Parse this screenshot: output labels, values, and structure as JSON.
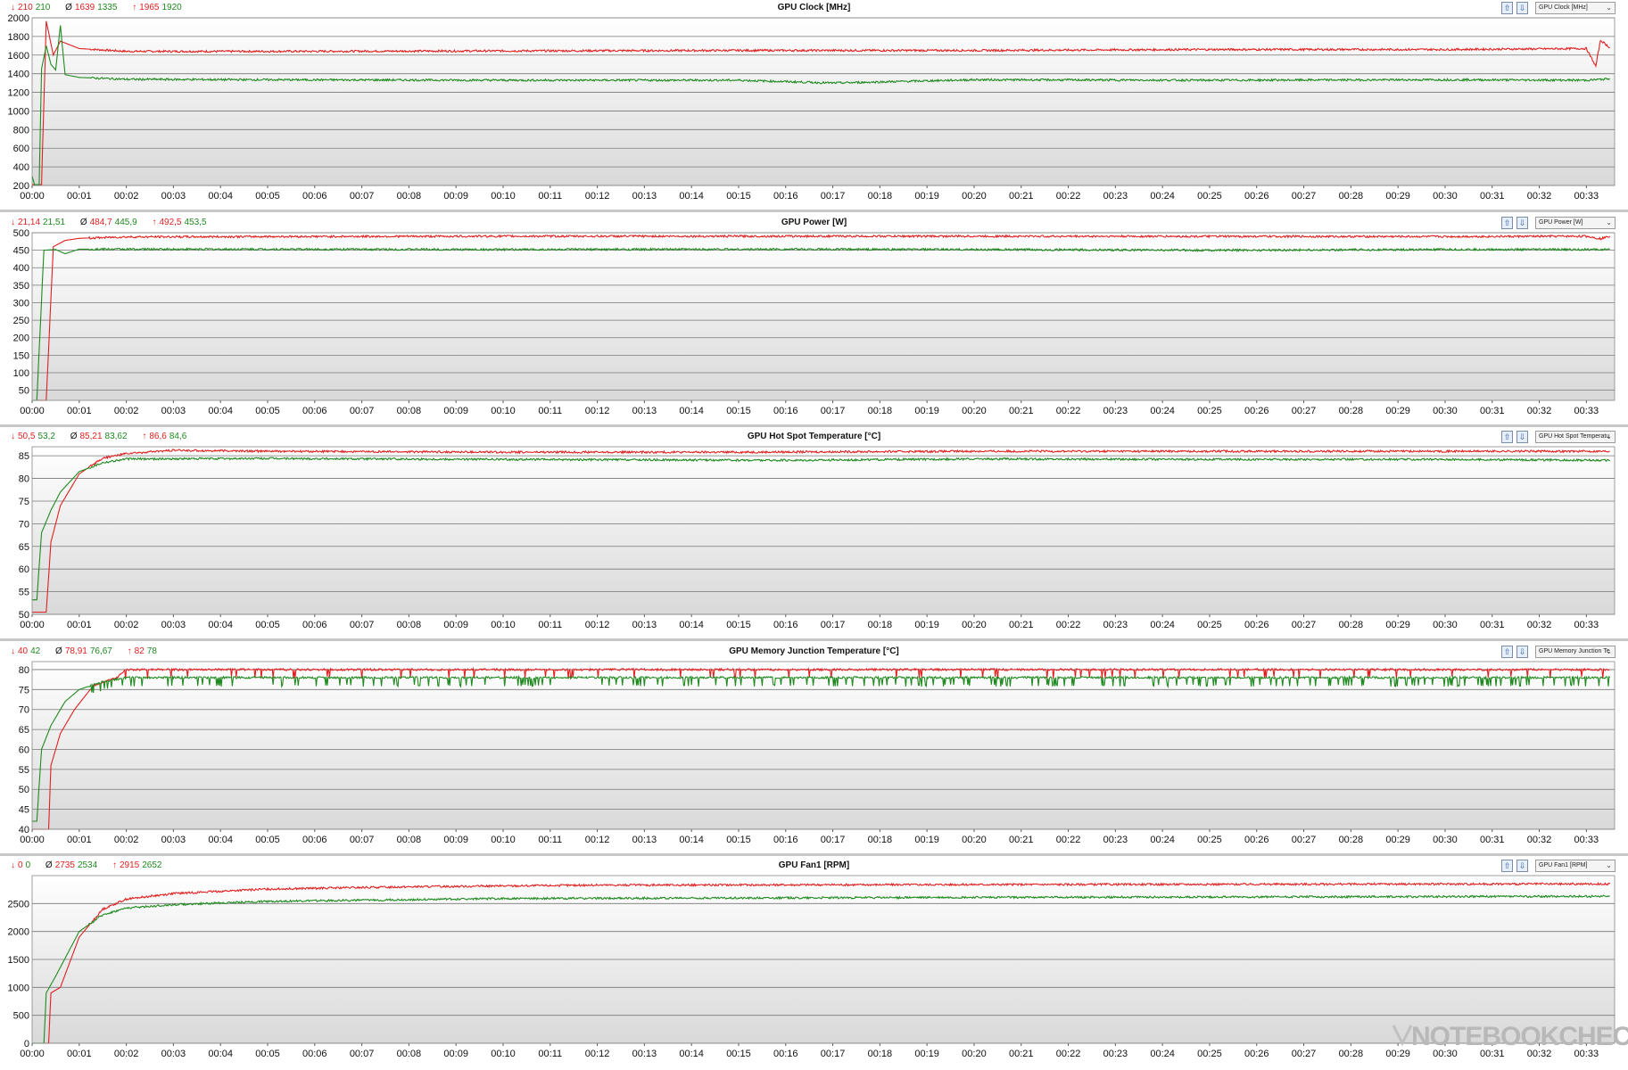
{
  "watermark": "NOTEBOOKCHECK",
  "colors": {
    "series_a": "#e02020",
    "series_b": "#1f8a1f",
    "grid": "#777777"
  },
  "time_labels": [
    "00:00",
    "00:01",
    "00:02",
    "00:03",
    "00:04",
    "00:05",
    "00:06",
    "00:07",
    "00:08",
    "00:09",
    "00:10",
    "00:11",
    "00:12",
    "00:13",
    "00:14",
    "00:15",
    "00:16",
    "00:17",
    "00:18",
    "00:19",
    "00:20",
    "00:21",
    "00:22",
    "00:23",
    "00:24",
    "00:25",
    "00:26",
    "00:27",
    "00:28",
    "00:29",
    "00:30",
    "00:31",
    "00:32",
    "00:33"
  ],
  "panels": [
    {
      "title": "GPU Clock [MHz]",
      "select_label": "GPU Clock [MHz]",
      "stats": {
        "min_a": "210",
        "min_b": "210",
        "avg_a": "1639",
        "avg_b": "1335",
        "max_a": "1965",
        "max_b": "1920"
      }
    },
    {
      "title": "GPU Power [W]",
      "select_label": "GPU Power [W]",
      "stats": {
        "min_a": "21,14",
        "min_b": "21,51",
        "avg_a": "484,7",
        "avg_b": "445,9",
        "max_a": "492,5",
        "max_b": "453,5"
      }
    },
    {
      "title": "GPU Hot Spot Temperature [°C]",
      "select_label": "GPU Hot Spot Temperatu",
      "stats": {
        "min_a": "50,5",
        "min_b": "53,2",
        "avg_a": "85,21",
        "avg_b": "83,62",
        "max_a": "86,6",
        "max_b": "84,6"
      }
    },
    {
      "title": "GPU Memory Junction Temperature [°C]",
      "select_label": "GPU Memory Junction Te",
      "stats": {
        "min_a": "40",
        "min_b": "42",
        "avg_a": "78,91",
        "avg_b": "76,67",
        "max_a": "82",
        "max_b": "78"
      }
    },
    {
      "title": "GPU Fan1 [RPM]",
      "select_label": "GPU Fan1 [RPM]",
      "stats": {
        "min_a": "0",
        "min_b": "0",
        "avg_a": "2735",
        "avg_b": "2534",
        "max_a": "2915",
        "max_b": "2652"
      }
    }
  ],
  "chart_data": [
    {
      "type": "line",
      "title": "GPU Clock [MHz]",
      "ylim": [
        200,
        2000
      ],
      "yticks": [
        "200",
        "400",
        "600",
        "800",
        "1000",
        "1200",
        "1400",
        "1600",
        "1800",
        "2000"
      ],
      "x_range_min": [
        0,
        33.6
      ],
      "series": [
        {
          "points": [
            [
              0,
              210
            ],
            [
              0.2,
              210
            ],
            [
              0.3,
              1965
            ],
            [
              0.45,
              1600
            ],
            [
              0.6,
              1750
            ],
            [
              1,
              1670
            ],
            [
              2,
              1640
            ],
            [
              5,
              1640
            ],
            [
              10,
              1645
            ],
            [
              15,
              1650
            ],
            [
              20,
              1650
            ],
            [
              25,
              1660
            ],
            [
              30,
              1660
            ],
            [
              33,
              1670
            ],
            [
              33.2,
              1480
            ],
            [
              33.3,
              1760
            ],
            [
              33.5,
              1680
            ]
          ]
        },
        {
          "points": [
            [
              0,
              300
            ],
            [
              0.05,
              210
            ],
            [
              0.15,
              210
            ],
            [
              0.2,
              1450
            ],
            [
              0.3,
              1700
            ],
            [
              0.4,
              1500
            ],
            [
              0.5,
              1440
            ],
            [
              0.6,
              1920
            ],
            [
              0.7,
              1390
            ],
            [
              1,
              1360
            ],
            [
              2,
              1340
            ],
            [
              5,
              1335
            ],
            [
              10,
              1330
            ],
            [
              15,
              1330
            ],
            [
              17,
              1300
            ],
            [
              20,
              1335
            ],
            [
              25,
              1330
            ],
            [
              30,
              1335
            ],
            [
              33,
              1330
            ],
            [
              33.5,
              1345
            ]
          ]
        }
      ]
    },
    {
      "type": "line",
      "title": "GPU Power [W]",
      "ylim": [
        21,
        500
      ],
      "yticks": [
        "50",
        "100",
        "150",
        "200",
        "250",
        "300",
        "350",
        "400",
        "450",
        "500"
      ],
      "x_range_min": [
        0,
        33.6
      ],
      "series": [
        {
          "points": [
            [
              0,
              21
            ],
            [
              0.3,
              21
            ],
            [
              0.45,
              460
            ],
            [
              0.7,
              478
            ],
            [
              1,
              484
            ],
            [
              2,
              488
            ],
            [
              5,
              489
            ],
            [
              10,
              490
            ],
            [
              20,
              490
            ],
            [
              30,
              489
            ],
            [
              33,
              490
            ],
            [
              33.3,
              483
            ],
            [
              33.5,
              490
            ]
          ]
        },
        {
          "points": [
            [
              0,
              21
            ],
            [
              0.1,
              21
            ],
            [
              0.25,
              450
            ],
            [
              0.5,
              452
            ],
            [
              0.7,
              440
            ],
            [
              1,
              453
            ],
            [
              5,
              453
            ],
            [
              10,
              452
            ],
            [
              16,
              453
            ],
            [
              20,
              452
            ],
            [
              25,
              450
            ],
            [
              30,
              452
            ],
            [
              33.5,
              452
            ]
          ]
        }
      ]
    },
    {
      "type": "line",
      "title": "GPU Hot Spot Temperature [°C]",
      "ylim": [
        50,
        87
      ],
      "yticks": [
        "50",
        "55",
        "60",
        "65",
        "70",
        "75",
        "80",
        "85"
      ],
      "x_range_min": [
        0,
        33.6
      ],
      "series": [
        {
          "points": [
            [
              0,
              50.5
            ],
            [
              0.3,
              50.5
            ],
            [
              0.4,
              66
            ],
            [
              0.6,
              74
            ],
            [
              1,
              81
            ],
            [
              1.5,
              84.5
            ],
            [
              2,
              85.5
            ],
            [
              3,
              86.2
            ],
            [
              5,
              86
            ],
            [
              10,
              85.8
            ],
            [
              15,
              85.8
            ],
            [
              20,
              86
            ],
            [
              25,
              86
            ],
            [
              30,
              86
            ],
            [
              33.5,
              86
            ]
          ]
        },
        {
          "points": [
            [
              0,
              53.2
            ],
            [
              0.1,
              53.2
            ],
            [
              0.2,
              68
            ],
            [
              0.4,
              73
            ],
            [
              0.6,
              77
            ],
            [
              1,
              81.5
            ],
            [
              1.5,
              83.5
            ],
            [
              2,
              84.3
            ],
            [
              5,
              84.4
            ],
            [
              10,
              84.2
            ],
            [
              16,
              84
            ],
            [
              20,
              84.3
            ],
            [
              25,
              84.2
            ],
            [
              30,
              84.2
            ],
            [
              33.5,
              84
            ]
          ]
        }
      ]
    },
    {
      "type": "line",
      "title": "GPU Memory Junction Temperature [°C]",
      "ylim": [
        40,
        82
      ],
      "yticks": [
        "40",
        "45",
        "50",
        "55",
        "60",
        "65",
        "70",
        "75",
        "80"
      ],
      "x_range_min": [
        0,
        33.6
      ],
      "series": [
        {
          "points": [
            [
              0,
              40
            ],
            [
              0.35,
              40
            ],
            [
              0.4,
              56
            ],
            [
              0.6,
              64
            ],
            [
              0.9,
              70
            ],
            [
              1.3,
              76
            ],
            [
              1.8,
              78
            ],
            [
              2,
              80
            ],
            [
              33.5,
              80
            ]
          ]
        },
        {
          "points": [
            [
              0,
              42
            ],
            [
              0.1,
              42
            ],
            [
              0.2,
              60
            ],
            [
              0.4,
              66
            ],
            [
              0.7,
              72
            ],
            [
              1,
              75
            ],
            [
              1.5,
              77
            ],
            [
              2,
              78
            ],
            [
              33.5,
              78
            ]
          ]
        }
      ]
    },
    {
      "type": "line",
      "title": "GPU Fan1 [RPM]",
      "ylim": [
        0,
        3000
      ],
      "yticks": [
        "0",
        "500",
        "1000",
        "1500",
        "2000",
        "2500"
      ],
      "x_range_min": [
        0,
        33.6
      ],
      "series": [
        {
          "points": [
            [
              0,
              0
            ],
            [
              0.35,
              0
            ],
            [
              0.4,
              900
            ],
            [
              0.6,
              1000
            ],
            [
              1,
              1900
            ],
            [
              1.5,
              2400
            ],
            [
              2,
              2580
            ],
            [
              3,
              2680
            ],
            [
              5,
              2760
            ],
            [
              8,
              2800
            ],
            [
              12,
              2830
            ],
            [
              20,
              2840
            ],
            [
              30,
              2850
            ],
            [
              33.5,
              2850
            ]
          ]
        },
        {
          "points": [
            [
              0,
              0
            ],
            [
              0.25,
              0
            ],
            [
              0.3,
              900
            ],
            [
              0.5,
              1200
            ],
            [
              1,
              2000
            ],
            [
              1.5,
              2300
            ],
            [
              2,
              2420
            ],
            [
              3,
              2480
            ],
            [
              5,
              2540
            ],
            [
              10,
              2590
            ],
            [
              20,
              2610
            ],
            [
              30,
              2625
            ],
            [
              33.5,
              2630
            ]
          ]
        }
      ]
    }
  ]
}
